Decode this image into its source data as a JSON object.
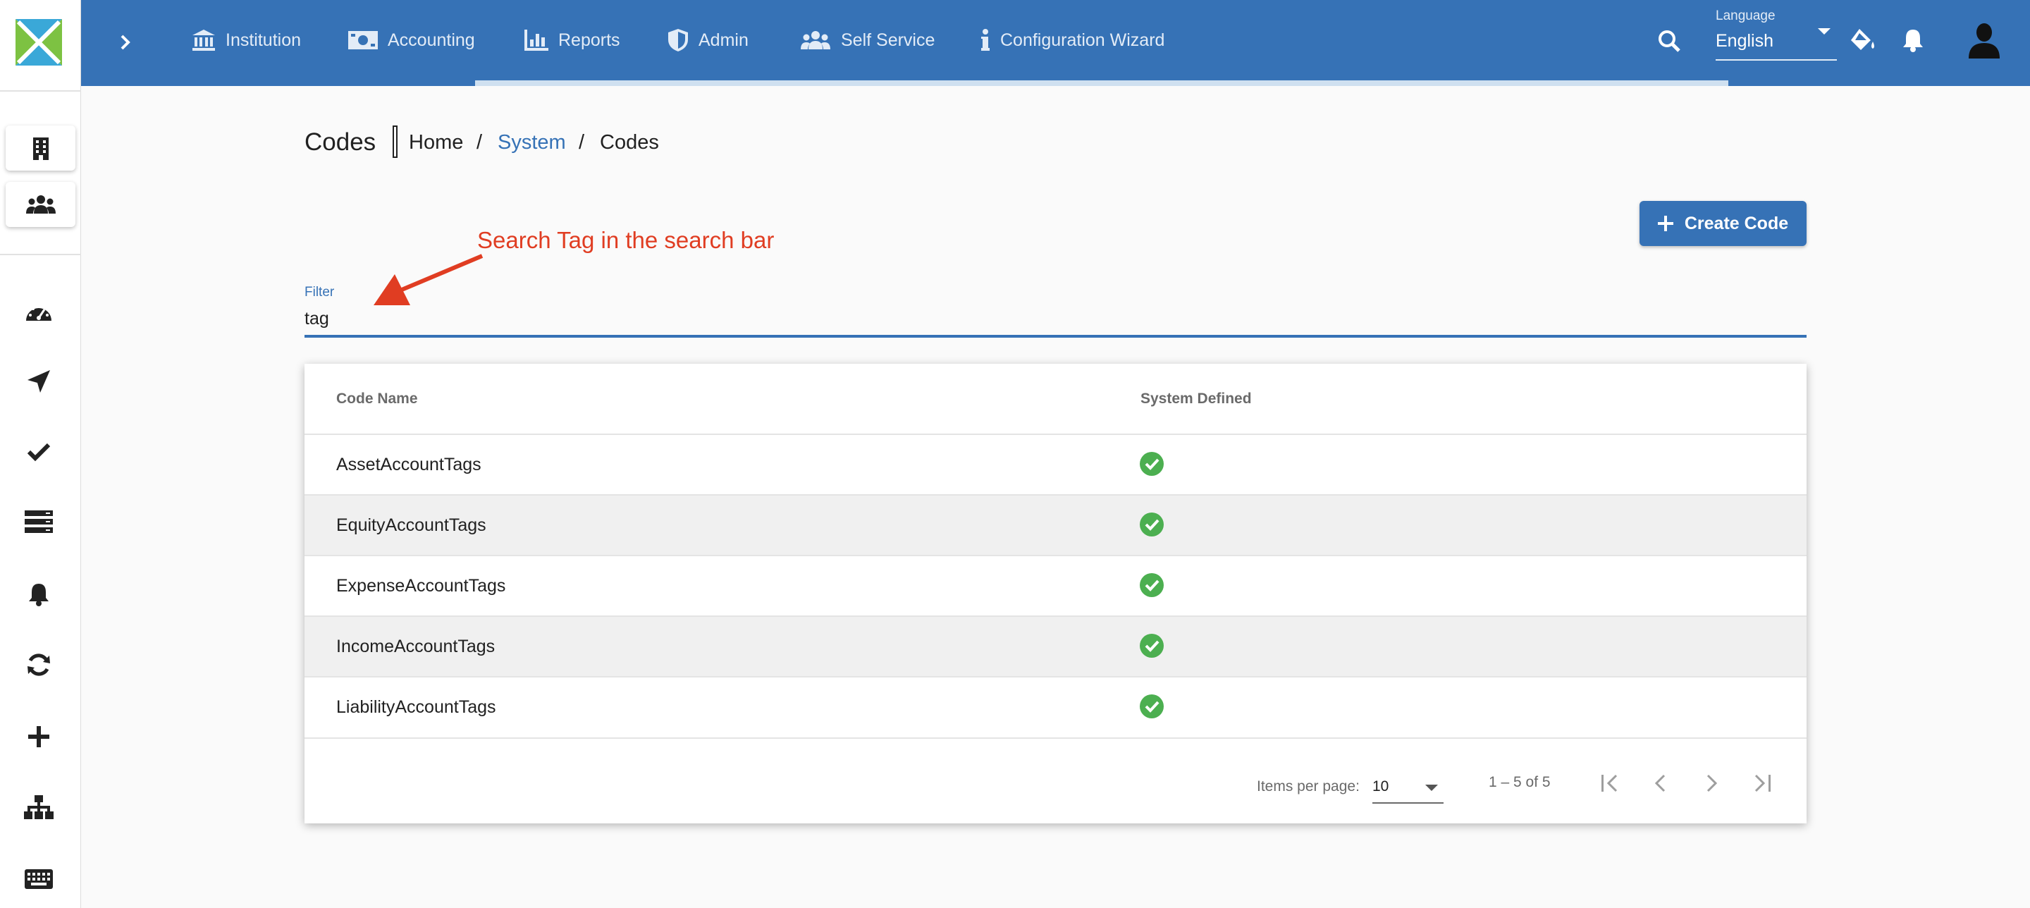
{
  "topbar": {
    "nav": [
      {
        "label": "Institution",
        "icon": "bank-icon"
      },
      {
        "label": "Accounting",
        "icon": "money-icon"
      },
      {
        "label": "Reports",
        "icon": "bar-chart-icon"
      },
      {
        "label": "Admin",
        "icon": "shield-icon"
      },
      {
        "label": "Self Service",
        "icon": "users-icon"
      },
      {
        "label": "Configuration Wizard",
        "icon": "info-icon"
      }
    ],
    "language": {
      "label": "Language",
      "value": "English"
    },
    "colors": {
      "bar": "#3672b6",
      "accent": "#cfe0f0"
    }
  },
  "sidebar": {
    "top_items": [
      "office-building-icon",
      "clients-group-icon"
    ],
    "items": [
      "dashboard-gauge-icon",
      "navigate-arrow-icon",
      "check-icon",
      "server-icon",
      "bell-icon",
      "refresh-icon",
      "plus-icon",
      "org-chart-icon",
      "keyboard-icon"
    ]
  },
  "page": {
    "title": "Codes",
    "breadcrumb": [
      "Home",
      "System",
      "Codes"
    ],
    "create_label": "Create Code"
  },
  "annotation": {
    "text": "Search Tag in the search bar",
    "color": "#e03d22"
  },
  "filter": {
    "label": "Filter",
    "value": "tag"
  },
  "table": {
    "columns": [
      "Code Name",
      "System Defined"
    ],
    "rows": [
      {
        "name": "AssetAccountTags",
        "system_defined": true
      },
      {
        "name": "EquityAccountTags",
        "system_defined": true
      },
      {
        "name": "ExpenseAccountTags",
        "system_defined": true
      },
      {
        "name": "IncomeAccountTags",
        "system_defined": true
      },
      {
        "name": "LiabilityAccountTags",
        "system_defined": true
      }
    ],
    "check_color": "#4caf50"
  },
  "paginator": {
    "items_per_page_label": "Items per page:",
    "items_per_page": "10",
    "range": "1 – 5 of 5"
  }
}
